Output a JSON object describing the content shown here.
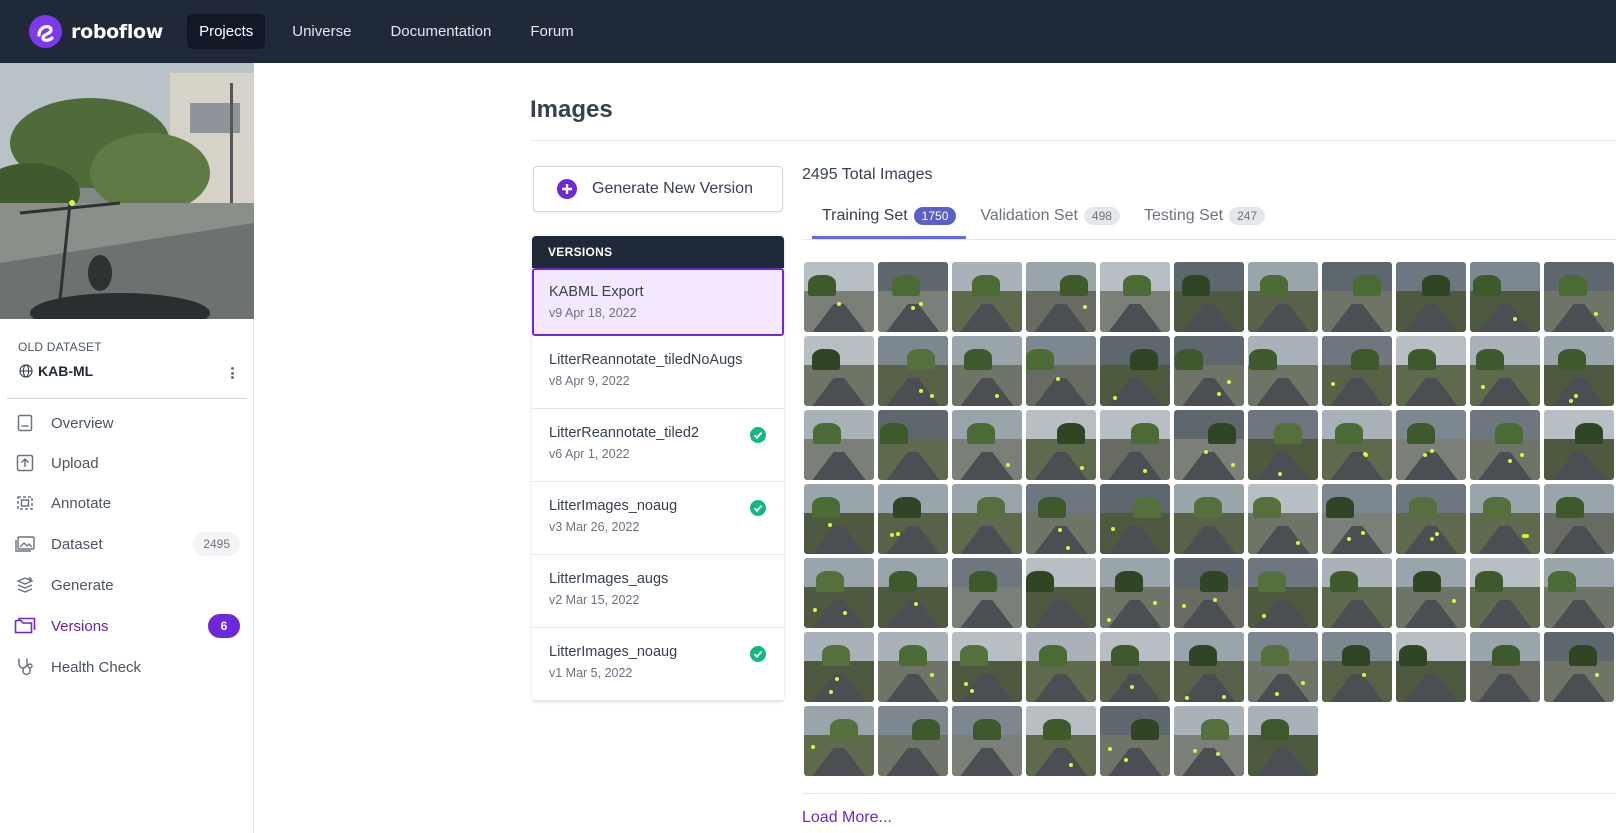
{
  "brand": {
    "name": "roboflow"
  },
  "nav": {
    "links": [
      {
        "label": "Projects",
        "active": true
      },
      {
        "label": "Universe",
        "active": false
      },
      {
        "label": "Documentation",
        "active": false
      },
      {
        "label": "Forum",
        "active": false
      }
    ]
  },
  "sidebar": {
    "dataset_label": "OLD DATASET",
    "dataset_name": "KAB-ML",
    "items": [
      {
        "label": "Overview",
        "icon": "document-icon"
      },
      {
        "label": "Upload",
        "icon": "upload-icon"
      },
      {
        "label": "Annotate",
        "icon": "annotate-icon"
      },
      {
        "label": "Dataset",
        "icon": "images-icon",
        "badge": "2495"
      },
      {
        "label": "Generate",
        "icon": "generate-icon"
      },
      {
        "label": "Versions",
        "icon": "folder-icon",
        "badge": "6",
        "active": true
      },
      {
        "label": "Health Check",
        "icon": "stethoscope-icon"
      }
    ]
  },
  "main": {
    "title": "Images",
    "generate_button": "Generate New Version",
    "versions_header": "VERSIONS",
    "versions": [
      {
        "name": "KABML Export",
        "meta": "v9 Apr 18, 2022",
        "selected": true,
        "checked": false
      },
      {
        "name": "LitterReannotate_tiledNoAugs",
        "meta": "v8 Apr 9, 2022",
        "selected": false,
        "checked": false
      },
      {
        "name": "LitterReannotate_tiled2",
        "meta": "v6 Apr 1, 2022",
        "selected": false,
        "checked": true
      },
      {
        "name": "LitterImages_noaug",
        "meta": "v3 Mar 26, 2022",
        "selected": false,
        "checked": true
      },
      {
        "name": "LitterImages_augs",
        "meta": "v2 Mar 15, 2022",
        "selected": false,
        "checked": false
      },
      {
        "name": "LitterImages_noaug",
        "meta": "v1 Mar 5, 2022",
        "selected": false,
        "checked": true
      }
    ],
    "total_images": "2495 Total Images",
    "tabs": [
      {
        "label": "Training Set",
        "count": "1750",
        "active": true
      },
      {
        "label": "Validation Set",
        "count": "498",
        "active": false
      },
      {
        "label": "Testing Set",
        "count": "247",
        "active": false
      }
    ],
    "thumbnail_count": 73,
    "load_more": "Load More..."
  },
  "colors": {
    "nav_bg": "#1f2937",
    "accent": "#6d28d9",
    "tab_accent": "#6366f1",
    "check": "#10b981"
  }
}
